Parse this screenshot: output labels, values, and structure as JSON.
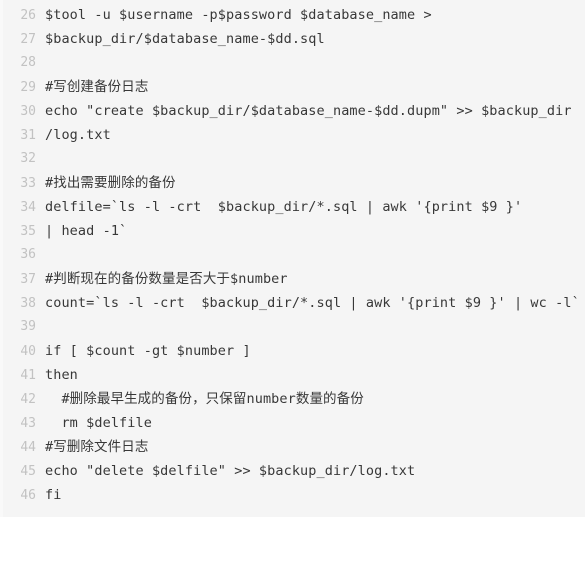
{
  "code_block": {
    "language": "shell",
    "background_color": "#f5f5f5",
    "text_color": "#383838",
    "line_number_color": "#c2c2c2",
    "first_line_number": 26,
    "last_line_number": 46,
    "lines": [
      {
        "number": "26",
        "text": "$tool -u $username -p$password $database_name >"
      },
      {
        "number": "27",
        "text": "$backup_dir/$database_name-$dd.sql"
      },
      {
        "number": "28",
        "text": ""
      },
      {
        "number": "29",
        "text": "#写创建备份日志"
      },
      {
        "number": "30",
        "text": "echo \"create $backup_dir/$database_name-$dd.dupm\" >> $backup_dir"
      },
      {
        "number": "31",
        "text": "/log.txt"
      },
      {
        "number": "32",
        "text": ""
      },
      {
        "number": "33",
        "text": "#找出需要删除的备份"
      },
      {
        "number": "34",
        "text": "delfile=`ls -l -crt  $backup_dir/*.sql | awk '{print $9 }'"
      },
      {
        "number": "35",
        "text": "| head -1`"
      },
      {
        "number": "36",
        "text": ""
      },
      {
        "number": "37",
        "text": "#判断现在的备份数量是否大于$number"
      },
      {
        "number": "38",
        "text": "count=`ls -l -crt  $backup_dir/*.sql | awk '{print $9 }' | wc -l`"
      },
      {
        "number": "39",
        "text": ""
      },
      {
        "number": "40",
        "text": "if [ $count -gt $number ]"
      },
      {
        "number": "41",
        "text": "then"
      },
      {
        "number": "42",
        "text": "  #删除最早生成的备份，只保留number数量的备份"
      },
      {
        "number": "43",
        "text": "  rm $delfile"
      },
      {
        "number": "44",
        "text": "#写删除文件日志"
      },
      {
        "number": "45",
        "text": "echo \"delete $delfile\" >> $backup_dir/log.txt"
      },
      {
        "number": "46",
        "text": "fi"
      }
    ]
  }
}
